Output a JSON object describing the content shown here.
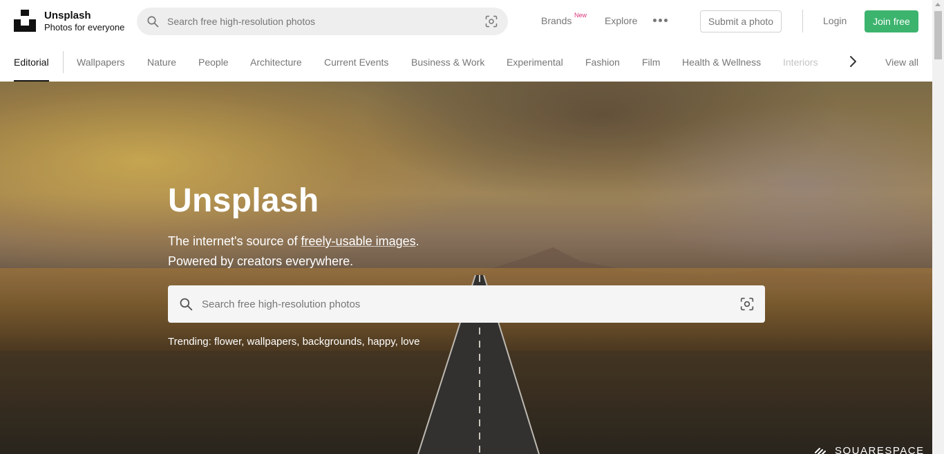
{
  "header": {
    "brand_name": "Unsplash",
    "brand_tagline": "Photos for everyone",
    "search_placeholder": "Search free high-resolution photos",
    "nav": {
      "brands": "Brands",
      "brands_badge": "New",
      "explore": "Explore"
    },
    "submit_label": "Submit a photo",
    "login_label": "Login",
    "join_label": "Join free"
  },
  "topics": {
    "items": [
      "Editorial",
      "Wallpapers",
      "Nature",
      "People",
      "Architecture",
      "Current Events",
      "Business & Work",
      "Experimental",
      "Fashion",
      "Film",
      "Health & Wellness",
      "Interiors"
    ],
    "active": "Editorial",
    "view_all": "View all"
  },
  "hero": {
    "title": "Unsplash",
    "subtitle_prefix": "The internet's source of ",
    "subtitle_link": "freely-usable images",
    "subtitle_suffix": ".",
    "subtitle_line2": "Powered by creators everywhere.",
    "search_placeholder": "Search free high-resolution photos",
    "trending_label": "Trending:",
    "trending": [
      "flower",
      "wallpapers",
      "backgrounds",
      "happy",
      "love"
    ],
    "sponsor": "SQUARESPACE"
  },
  "colors": {
    "accent_green": "#3cb46e",
    "new_badge": "#d8337b",
    "muted_text": "#767676"
  },
  "icons": [
    "unsplash-logo-icon",
    "search-icon",
    "visual-search-icon",
    "more-dots-icon",
    "chevron-right-icon",
    "squarespace-logo-icon"
  ]
}
